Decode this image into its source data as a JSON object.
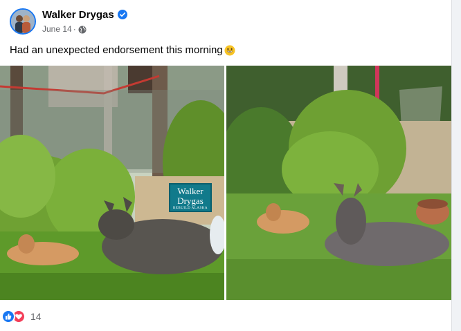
{
  "post": {
    "author": "Walker Drygas",
    "date": "June 14",
    "separator": "·",
    "caption": "Had an unexpected endorsement this morning",
    "reaction_count": "14"
  },
  "sign": {
    "line1": "Walker",
    "line2": "Drygas",
    "line3": "REBUILD ALASKA"
  },
  "icons": {
    "verified": "verified-badge-icon",
    "audience": "globe-icon",
    "emoji": "grinning-face-emoji",
    "reactions": [
      "like-icon",
      "love-icon"
    ]
  },
  "colors": {
    "accent": "#1877f2",
    "love": "#f33e58",
    "secondary_text": "#65676b"
  }
}
